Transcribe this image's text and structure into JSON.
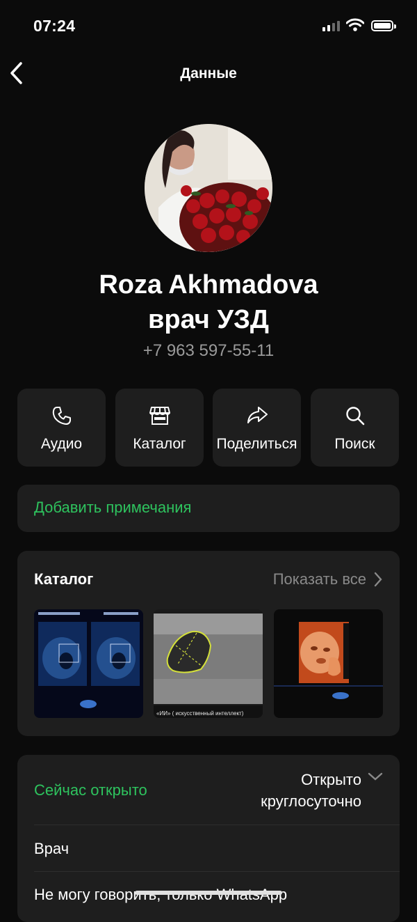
{
  "status_bar": {
    "time": "07:24"
  },
  "header": {
    "title": "Данные"
  },
  "profile": {
    "name_line1": "Roza Akhmadova",
    "name_line2": "врач УЗД",
    "phone": "+7 963 597-55-11"
  },
  "actions": [
    {
      "label": "Аудио",
      "icon": "phone-icon"
    },
    {
      "label": "Каталог",
      "icon": "store-icon"
    },
    {
      "label": "Поделиться",
      "icon": "share-icon"
    },
    {
      "label": "Поиск",
      "icon": "search-icon"
    }
  ],
  "notes": {
    "label": "Добавить примечания"
  },
  "catalog": {
    "title": "Каталог",
    "show_all": "Показать все",
    "thumb_caption": "«ИИ» ( искусственный интеллект)"
  },
  "hours": {
    "status_label": "Сейчас открыто",
    "value_line1": "Открыто",
    "value_line2": "круглосуточно"
  },
  "details": {
    "category": "Врач",
    "about": "Не могу говорить, только WhatsApp"
  },
  "colors": {
    "accent_green": "#2ec35e",
    "background": "#0b0b0b",
    "card": "#1e1e1e"
  }
}
